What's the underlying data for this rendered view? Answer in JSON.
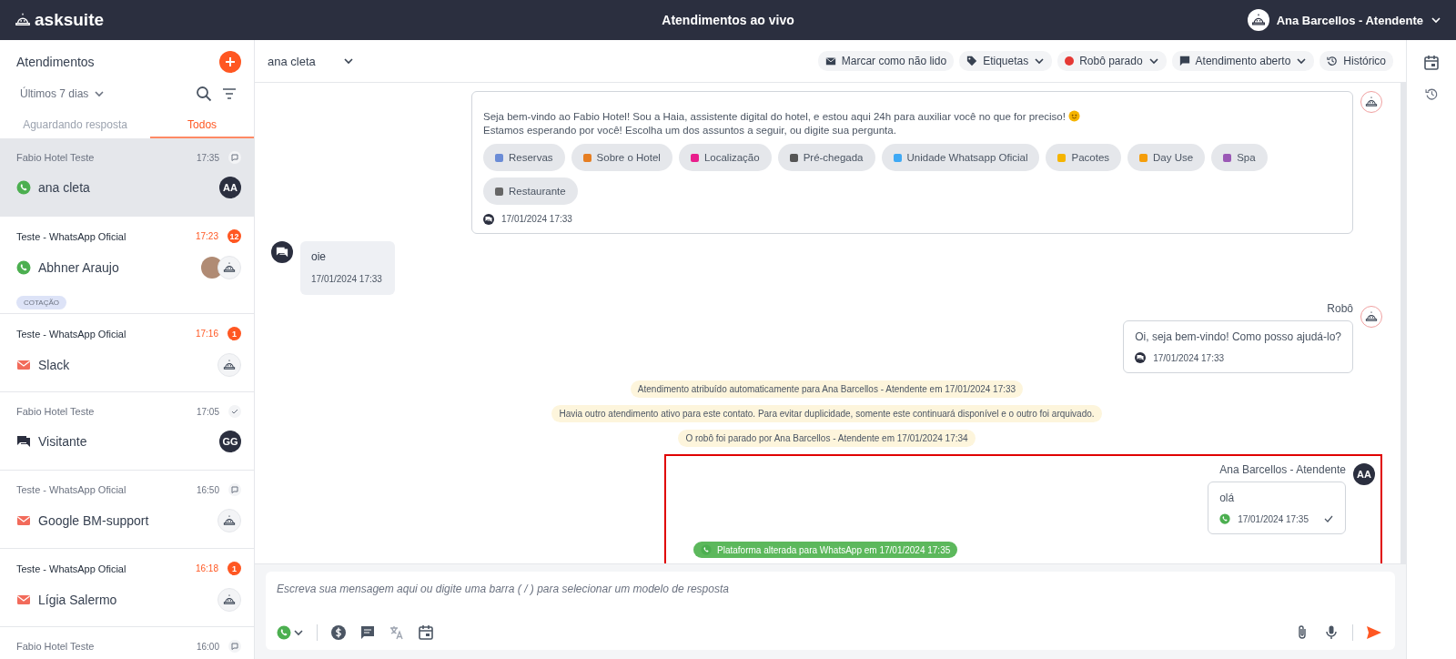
{
  "top_bar": {
    "logo": "asksuite",
    "title": "Atendimentos ao vivo",
    "user": "Ana Barcellos - Atendente"
  },
  "sidebar": {
    "title": "Atendimentos",
    "period": "Últimos 7 dias",
    "tabs": [
      {
        "label": "Aguardando resposta",
        "selected": false
      },
      {
        "label": "Todos",
        "selected": true
      }
    ],
    "conversations": [
      {
        "account": "Fabio Hotel Teste",
        "time": "17:35",
        "unread": false,
        "badge": {
          "kind": "bubble"
        },
        "channel": {
          "kind": "whatsapp"
        },
        "name": "ana cleta",
        "avatar": {
          "kind": "initials",
          "text": "AA"
        },
        "selected": true
      },
      {
        "account": "Teste - WhatsApp Oficial",
        "time": "17:23",
        "unread": true,
        "badge": {
          "kind": "count",
          "text": "12"
        },
        "channel": {
          "kind": "whatsapp"
        },
        "name": "Abhner Araujo",
        "avatar": {
          "kind": "photo_bot"
        },
        "tags": [
          "COTAÇÃO"
        ],
        "selected": false
      },
      {
        "account": "Teste - WhatsApp Oficial",
        "time": "17:16",
        "unread": true,
        "badge": {
          "kind": "count",
          "text": "1"
        },
        "channel": {
          "kind": "email"
        },
        "name": "Slack",
        "avatar": {
          "kind": "bot"
        },
        "selected": false
      },
      {
        "account": "Fabio Hotel Teste",
        "time": "17:05",
        "unread": false,
        "badge": {
          "kind": "check"
        },
        "channel": {
          "kind": "chat"
        },
        "name": "Visitante",
        "avatar": {
          "kind": "initials",
          "text": "GG"
        },
        "selected": false
      },
      {
        "account": "Teste - WhatsApp Oficial",
        "time": "16:50",
        "unread": false,
        "badge": {
          "kind": "bubble"
        },
        "channel": {
          "kind": "email"
        },
        "name": "Google BM-support",
        "avatar": {
          "kind": "bot"
        },
        "selected": false
      },
      {
        "account": "Teste - WhatsApp Oficial",
        "time": "16:18",
        "unread": true,
        "badge": {
          "kind": "count",
          "text": "1"
        },
        "channel": {
          "kind": "email"
        },
        "name": "Lígia Salermo",
        "avatar": {
          "kind": "bot"
        },
        "selected": false
      },
      {
        "account": "Fabio Hotel Teste",
        "time": "16:00",
        "unread": false,
        "badge": {
          "kind": "bubble"
        },
        "selected": false
      }
    ]
  },
  "chat_header": {
    "contact": "ana cleta",
    "actions": [
      {
        "kind": "mark",
        "label": "Marcar como não lido",
        "dropdown": false
      },
      {
        "kind": "tag",
        "label": "Etiquetas",
        "dropdown": true
      },
      {
        "kind": "robot",
        "label": "Robô parado",
        "dropdown": true,
        "color": "#e53935"
      },
      {
        "kind": "status",
        "label": "Atendimento aberto",
        "dropdown": true
      },
      {
        "kind": "history",
        "label": "Histórico",
        "dropdown": false
      }
    ]
  },
  "messages": [
    {
      "kind": "bot_menu",
      "text_before": "Seja bem-vindo ao Fabio Hotel! Sou a Haia, assistente digital do hotel, e estou aqui 24h para auxiliar você no que for preciso!",
      "text_after": "Estamos esperando por você! Escolha um dos assuntos a seguir, ou digite sua pergunta.",
      "options": [
        "Reservas",
        "Sobre o Hotel",
        "Localização",
        "Pré-chegada",
        "Unidade Whatsapp Oficial",
        "Pacotes",
        "Day Use",
        "Spa",
        "Restaurante"
      ],
      "time": "17/01/2024 17:33"
    },
    {
      "kind": "incoming",
      "text": "oie",
      "time": "17/01/2024 17:33"
    },
    {
      "kind": "bot",
      "sender": "Robô",
      "text": "Oi, seja bem-vindo! Como posso ajudá-lo?",
      "time": "17/01/2024 17:33"
    },
    {
      "kind": "system",
      "text": "Atendimento atribuído automaticamente para Ana Barcellos - Atendente em 17/01/2024 17:33"
    },
    {
      "kind": "system",
      "text": "Havia outro atendimento ativo para este contato. Para evitar duplicidade, somente este continuará disponível e o outro foi arquivado."
    },
    {
      "kind": "system",
      "text": "O robô foi parado por Ana Barcellos - Atendente em 17/01/2024 17:34"
    }
  ],
  "highlighted_messages": [
    {
      "kind": "agent",
      "sender": "Ana Barcellos - Atendente",
      "initials": "AA",
      "text": "olá",
      "time": "17/01/2024 17:35",
      "delivered": true
    },
    {
      "kind": "platform",
      "text": "Plataforma alterada para WhatsApp em 17/01/2024 17:35"
    }
  ],
  "composer": {
    "placeholder": "Escreva sua mensagem aqui ou digite uma barra ( / ) para selecionar um modelo de resposta"
  }
}
